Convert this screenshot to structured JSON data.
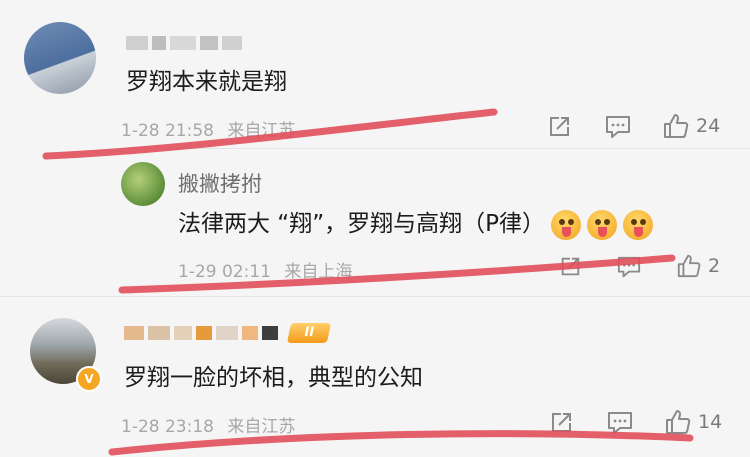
{
  "comments": [
    {
      "username": "",
      "text": "罗翔本来就是翔",
      "date": "1-28 21:58",
      "location": "来自江苏",
      "like_count": "24"
    },
    {
      "username": "搬撇拷拊",
      "text": "法律两大 “翔”，罗翔与高翔（P律）",
      "date": "1-29 02:11",
      "location": "来自上海",
      "like_count": "2"
    },
    {
      "username": "",
      "text": "罗翔一脸的坏相，典型的公知",
      "date": "1-28 23:18",
      "location": "来自江苏",
      "like_count": "14"
    }
  ],
  "badge_text": "II",
  "icons": [
    "share-icon",
    "comment-icon",
    "like-icon",
    "emoji-grin-tongue-icon",
    "verified-v-icon"
  ],
  "colors": {
    "background": "#f5f5f5",
    "annotation_red": "#e04a55",
    "meta_text": "#a7a7a7",
    "name_text": "#6f6f6f"
  }
}
